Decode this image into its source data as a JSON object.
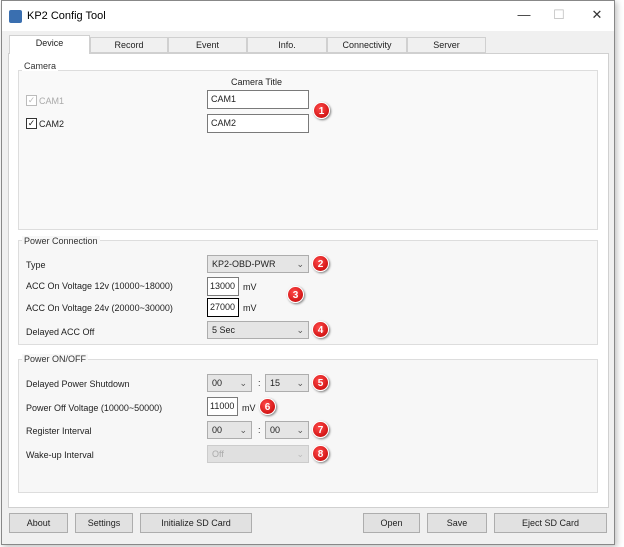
{
  "window": {
    "title": "KP2 Config Tool",
    "minimize": "—",
    "maximize": "☐",
    "close": "✕"
  },
  "tabs": [
    {
      "label": "Device"
    },
    {
      "label": "Record"
    },
    {
      "label": "Event"
    },
    {
      "label": "Info."
    },
    {
      "label": "Connectivity"
    },
    {
      "label": "Server"
    }
  ],
  "camera": {
    "group": "Camera",
    "column_header": "Camera Title",
    "cams": [
      {
        "label": "CAM1",
        "checked": true,
        "disabled": true,
        "title": "CAM1"
      },
      {
        "label": "CAM2",
        "checked": true,
        "disabled": false,
        "title": "CAM2"
      }
    ],
    "badge": "1"
  },
  "power_connection": {
    "group": "Power Connection",
    "type_label": "Type",
    "type_value": "KP2-OBD-PWR",
    "badge_type": "2",
    "acc12_label": "ACC On Voltage 12v (10000~18000)",
    "acc12_value": "13000",
    "acc24_label": "ACC On Voltage 24v (20000~30000)",
    "acc24_value": "27000",
    "unit": "mV",
    "badge_acc": "3",
    "delayed_acc_label": "Delayed ACC Off",
    "delayed_acc_value": "5 Sec",
    "badge_delayed": "4"
  },
  "power_onoff": {
    "group": "Power ON/OFF",
    "shutdown_label": "Delayed Power Shutdown",
    "shutdown_h": "00",
    "shutdown_m": "15",
    "badge_shutdown": "5",
    "off_voltage_label": "Power Off Voltage (10000~50000)",
    "off_voltage_value": "11000",
    "unit": "mV",
    "badge_off": "6",
    "register_label": "Register Interval",
    "register_h": "00",
    "register_m": "00",
    "badge_register": "7",
    "wakeup_label": "Wake-up Interval",
    "wakeup_value": "Off",
    "badge_wakeup": "8",
    "sep": ":"
  },
  "buttons": {
    "about": "About",
    "settings": "Settings",
    "init_sd": "Initialize SD Card",
    "open": "Open",
    "save": "Save",
    "eject_sd": "Eject SD Card"
  },
  "chev": "⌄"
}
